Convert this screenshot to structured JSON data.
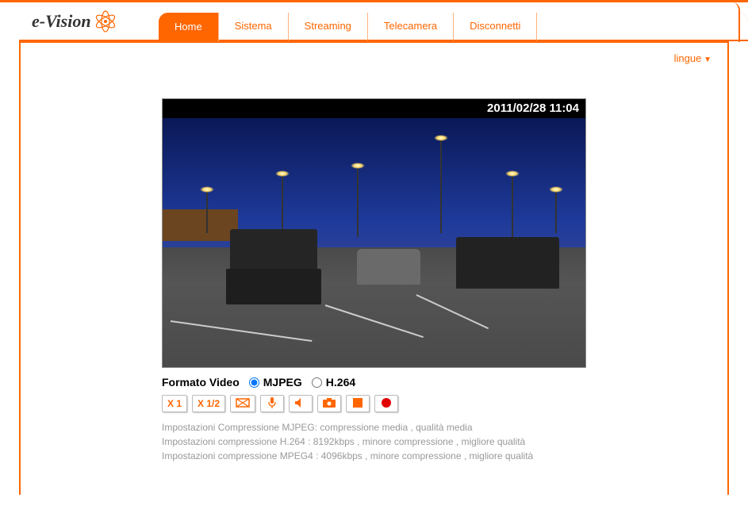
{
  "logo": {
    "text": "e-Vision"
  },
  "nav": {
    "home": "Home",
    "sistema": "Sistema",
    "streaming": "Streaming",
    "telecamera": "Telecamera",
    "disconnetti": "Disconnetti"
  },
  "lang": {
    "label": "lingue"
  },
  "video": {
    "timestamp": "2011/02/28 11:04"
  },
  "format": {
    "label": "Formato Video",
    "option1": "MJPEG",
    "option2": "H.264"
  },
  "controls": {
    "zoom1": "X 1",
    "zoom_half": "X 1/2"
  },
  "info": {
    "line1": "Impostazioni Compressione MJPEG: compressione media , qualità media",
    "line2": "Impostazioni compressione H.264  : 8192kbps , minore compressione , migliore qualità",
    "line3": "Impostazioni compressione MPEG4 : 4096kbps , minore compressione , migliore qualità"
  }
}
